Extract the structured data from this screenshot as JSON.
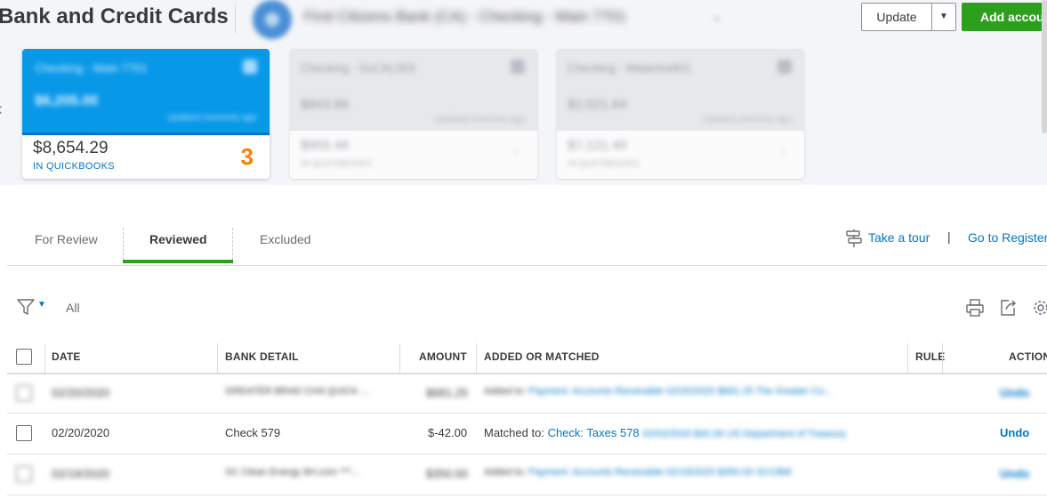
{
  "header": {
    "title": "Bank and Credit Cards",
    "account_name": "First Citizens Bank (CA) - Checking - Main 7701",
    "update_label": "Update",
    "add_account_label": "Add account"
  },
  "cards": {
    "main": {
      "title": "Checking - Main 7701",
      "bank_balance": "$6,205.00",
      "bank_sub": "Updated moments ago",
      "qb_amount": "$8,654.29",
      "qb_label": "IN QUICKBOOKS",
      "count": "3"
    },
    "second": {
      "title": "Checking - SoCAL003",
      "bank_balance": "$843.86",
      "bank_sub": "Updated moments ago",
      "qb_amount": "$955.46",
      "qb_label": "IN QUICKBOOKS"
    },
    "third": {
      "title": "Checking - Waterloo801",
      "bank_balance": "$2,521.64",
      "bank_sub": "Updated moments ago",
      "qb_amount": "$7,121.40",
      "qb_label": "IN QUICKBOOKS"
    }
  },
  "tabs": [
    {
      "label": "For Review"
    },
    {
      "label": "Reviewed"
    },
    {
      "label": "Excluded"
    }
  ],
  "links": {
    "tour": "Take a tour",
    "pipe": "|",
    "register": "Go to Register"
  },
  "filter": {
    "label": "All"
  },
  "table": {
    "headers": {
      "date": "DATE",
      "bank_detail": "BANK DETAIL",
      "amount": "AMOUNT",
      "added_or_matched": "ADDED OR MATCHED",
      "rule": "RULE",
      "action": "ACTION"
    },
    "rows": [
      {
        "date": "02/20/2020",
        "bank_detail": "GREATER BRAD CHA QUICK ...",
        "amount": "$681.25",
        "added_prefix": "Added to:",
        "added_link": "Payment: Accounts Receivable",
        "added_detail": "02/20/2020 $681.25 The Greater Co...",
        "action": "Undo"
      },
      {
        "date": "02/20/2020",
        "bank_detail": "Check 579",
        "amount": "$-42.00",
        "added_prefix": "Matched to:",
        "added_link": "Check: Taxes 578",
        "added_detail": "02/02/2020 $42.00 US Department of Treasury",
        "action": "Undo"
      },
      {
        "date": "02/19/2020",
        "bank_detail": "SC Clean Energy 8H.com ***...",
        "amount": "$350.00",
        "added_prefix": "Added to:",
        "added_link": "Payment: Accounts Receivable",
        "added_detail": "02/19/2020 $350.00 SCCBM",
        "action": "Undo"
      }
    ]
  }
}
